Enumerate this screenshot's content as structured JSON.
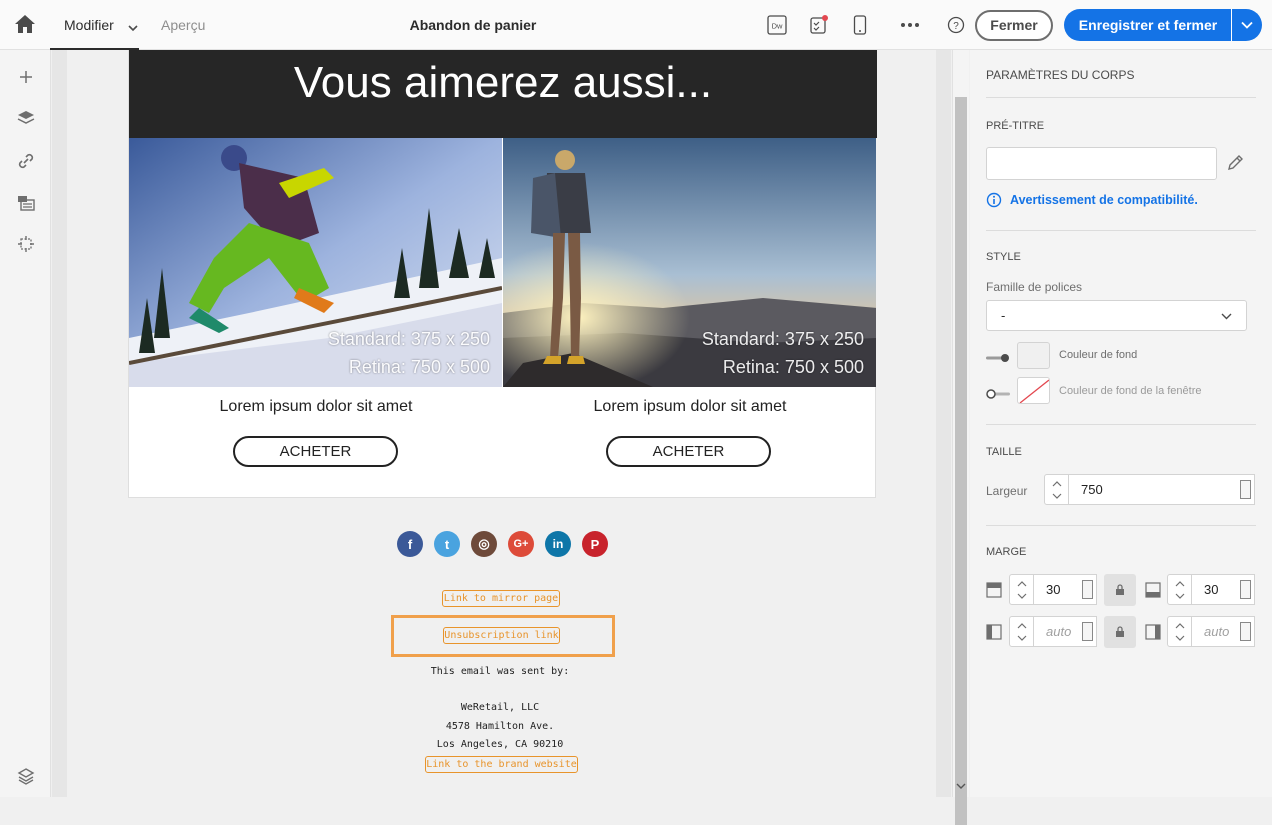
{
  "toolbar": {
    "home_icon": "home-icon",
    "tab_edit": "Modifier",
    "tab_preview": "Aperçu",
    "title": "Abandon de panier",
    "dw_icon_label": "Dw",
    "close_label": "Fermer",
    "save_label": "Enregistrer et fermer",
    "accent": "#1473e6"
  },
  "left_rail": {
    "icons": [
      "add-icon",
      "layers-icon",
      "link-icon",
      "fragment-icon",
      "structure-icon",
      "navigation-tree-icon"
    ]
  },
  "email": {
    "hero_title": "Vous aimerez aussi...",
    "products": [
      {
        "caption_line1": "Standard: 375 x 250",
        "caption_line2": "Retina: 750 x 500",
        "title": "Lorem ipsum dolor sit amet",
        "button": "ACHETER"
      },
      {
        "caption_line1": "Standard: 375 x 250",
        "caption_line2": "Retina: 750 x 500",
        "title": "Lorem ipsum dolor sit amet",
        "button": "ACHETER"
      }
    ],
    "social_icons": [
      "facebook-icon",
      "twitter-icon",
      "instagram-icon",
      "google-plus-icon",
      "linkedin-icon",
      "pinterest-icon"
    ],
    "social_glyphs": {
      "facebook": "f",
      "twitter": "t",
      "instagram": "◎",
      "gplus": "G+",
      "linkedin": "in",
      "pinterest": "P"
    },
    "mirror_link": "Link to mirror page",
    "unsub_link": "Unsubscription link",
    "sent_by": "This email was sent by:",
    "company": "WeRetail, LLC",
    "address1": "4578 Hamilton Ave.",
    "address2": "Los Angeles, CA 90210",
    "brand_link": "Link to the brand website"
  },
  "panel": {
    "header": "PARAMÈTRES DU CORPS",
    "pretitle_label": "PRÉ-TITRE",
    "pretitle_value": "",
    "compat_warning": "Avertissement de compatibilité.",
    "style_label": "STYLE",
    "font_family_label": "Famille de polices",
    "font_family_value": "-",
    "bg_color_label": "Couleur de fond",
    "window_bg_label": "Couleur de fond de la fenêtre",
    "size_label": "TAILLE",
    "width_label": "Largeur",
    "width_value": "750",
    "margin_label": "MARGE",
    "margin_top": "30",
    "margin_bottom": "30",
    "margin_left": "auto",
    "margin_right": "auto"
  }
}
